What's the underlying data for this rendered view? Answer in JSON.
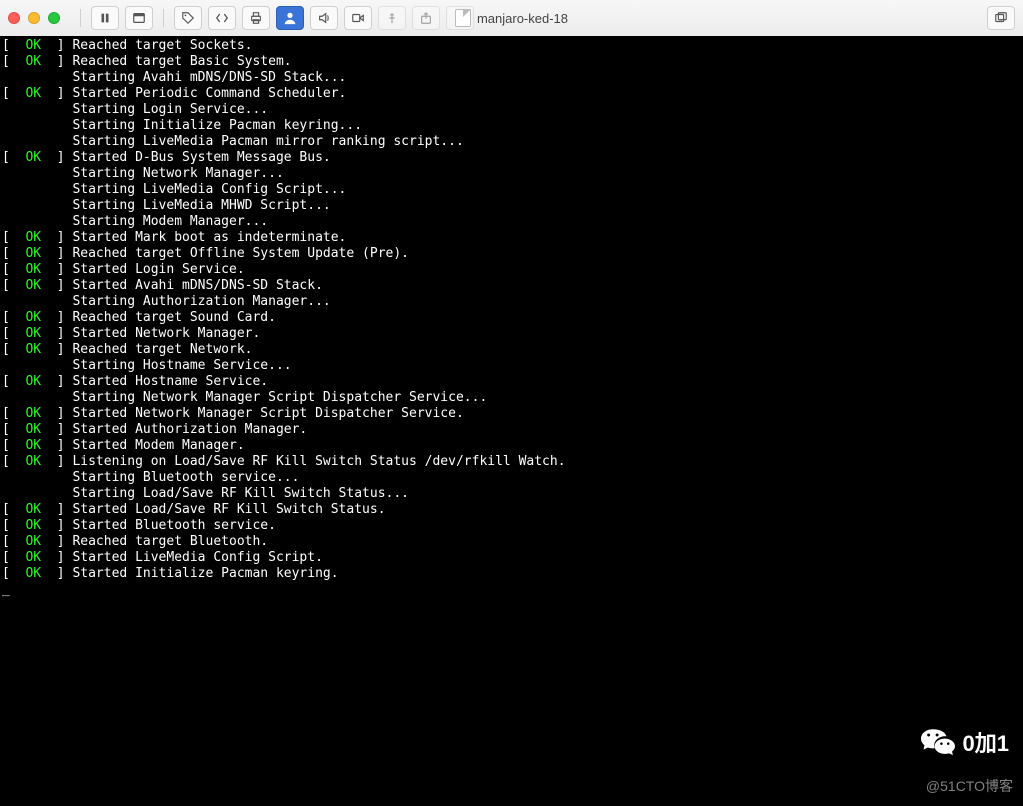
{
  "window": {
    "title": "manjaro-ked-18"
  },
  "toolbar": {
    "icons": {
      "close": "close-icon",
      "minimize": "minimize-icon",
      "zoom": "zoom-icon",
      "pause": "pause-icon",
      "view": "view-icon",
      "tag": "tag-icon",
      "code": "code-icon",
      "print": "print-icon",
      "person": "person-icon",
      "audio": "audio-icon",
      "video": "video-icon",
      "usb": "usb-icon",
      "share": "share-icon",
      "last": "last-icon",
      "windows": "windows-icon"
    }
  },
  "watermarks": {
    "wechat_label": "0加1",
    "blog": "@51CTO博客"
  },
  "boot_lines": [
    {
      "status": "OK",
      "msg": "Reached target Sockets."
    },
    {
      "status": "OK",
      "msg": "Reached target Basic System."
    },
    {
      "status": null,
      "msg": "Starting Avahi mDNS/DNS-SD Stack..."
    },
    {
      "status": "OK",
      "msg": "Started Periodic Command Scheduler."
    },
    {
      "status": null,
      "msg": "Starting Login Service..."
    },
    {
      "status": null,
      "msg": "Starting Initialize Pacman keyring..."
    },
    {
      "status": null,
      "msg": "Starting LiveMedia Pacman mirror ranking script..."
    },
    {
      "status": "OK",
      "msg": "Started D-Bus System Message Bus."
    },
    {
      "status": null,
      "msg": "Starting Network Manager..."
    },
    {
      "status": null,
      "msg": "Starting LiveMedia Config Script..."
    },
    {
      "status": null,
      "msg": "Starting LiveMedia MHWD Script..."
    },
    {
      "status": null,
      "msg": "Starting Modem Manager..."
    },
    {
      "status": "OK",
      "msg": "Started Mark boot as indeterminate."
    },
    {
      "status": "OK",
      "msg": "Reached target Offline System Update (Pre)."
    },
    {
      "status": "OK",
      "msg": "Started Login Service."
    },
    {
      "status": "OK",
      "msg": "Started Avahi mDNS/DNS-SD Stack."
    },
    {
      "status": null,
      "msg": "Starting Authorization Manager..."
    },
    {
      "status": "OK",
      "msg": "Reached target Sound Card."
    },
    {
      "status": "OK",
      "msg": "Started Network Manager."
    },
    {
      "status": "OK",
      "msg": "Reached target Network."
    },
    {
      "status": null,
      "msg": "Starting Hostname Service..."
    },
    {
      "status": "OK",
      "msg": "Started Hostname Service."
    },
    {
      "status": null,
      "msg": "Starting Network Manager Script Dispatcher Service..."
    },
    {
      "status": "OK",
      "msg": "Started Network Manager Script Dispatcher Service."
    },
    {
      "status": "OK",
      "msg": "Started Authorization Manager."
    },
    {
      "status": "OK",
      "msg": "Started Modem Manager."
    },
    {
      "status": "OK",
      "msg": "Listening on Load/Save RF Kill Switch Status /dev/rfkill Watch."
    },
    {
      "status": null,
      "msg": "Starting Bluetooth service..."
    },
    {
      "status": null,
      "msg": "Starting Load/Save RF Kill Switch Status..."
    },
    {
      "status": "OK",
      "msg": "Started Load/Save RF Kill Switch Status."
    },
    {
      "status": "OK",
      "msg": "Started Bluetooth service."
    },
    {
      "status": "OK",
      "msg": "Reached target Bluetooth."
    },
    {
      "status": "OK",
      "msg": "Started LiveMedia Config Script."
    },
    {
      "status": "OK",
      "msg": "Started Initialize Pacman keyring."
    }
  ]
}
